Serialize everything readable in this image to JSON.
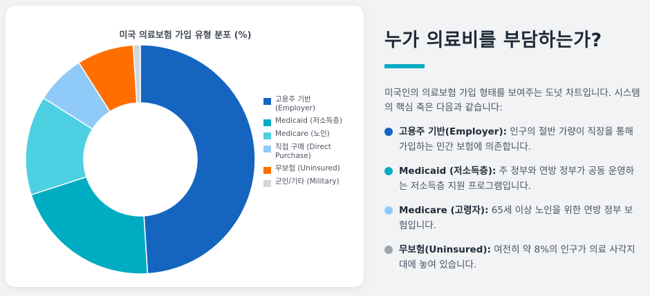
{
  "chart_data": {
    "type": "pie",
    "title": "미국 의료보험 가입 유형 분포 (%)",
    "series": [
      {
        "name": "고용주 기반\n(Employer)",
        "value": 49,
        "color": "#1565c0"
      },
      {
        "name": "Medicaid (저소득층)",
        "value": 21,
        "color": "#00acc1"
      },
      {
        "name": "Medicare (노인)",
        "value": 14,
        "color": "#4dd0e1"
      },
      {
        "name": "직접 구매 (Direct\nPurchase)",
        "value": 7,
        "color": "#90caf9"
      },
      {
        "name": "무보험 (Uninsured)",
        "value": 8,
        "color": "#ff6f00"
      },
      {
        "name": "군인/기타 (Military)",
        "value": 1,
        "color": "#cfd8dc"
      }
    ]
  },
  "panel": {
    "heading": "누가 의료비를 부담하는가?",
    "intro": "미국인의 의료보험 가입 형태를 보여주는 도넛 차트입니다. 시스템의 핵심 축은 다음과 같습니다:",
    "bullets": [
      {
        "title": "고용주 기반(Employer):",
        "text": " 인구의 절반 가량이 직장을 통해 가입하는 민간 보험에 의존합니다.",
        "color": "#1565c0"
      },
      {
        "title": "Medicaid (저소득층):",
        "text": " 주 정부와 연방 정부가 공동 운영하는 저소득층 지원 프로그램입니다.",
        "color": "#00acc1"
      },
      {
        "title": "Medicare (고령자):",
        "text": " 65세 이상 노인을 위한 연방 정부 보험입니다.",
        "color": "#90caf9"
      },
      {
        "title": "무보험(Uninsured):",
        "text": " 여전히 약 8%의 인구가 의료 사각지대에 놓여 있습니다.",
        "color": "#9aa3ae"
      }
    ]
  }
}
